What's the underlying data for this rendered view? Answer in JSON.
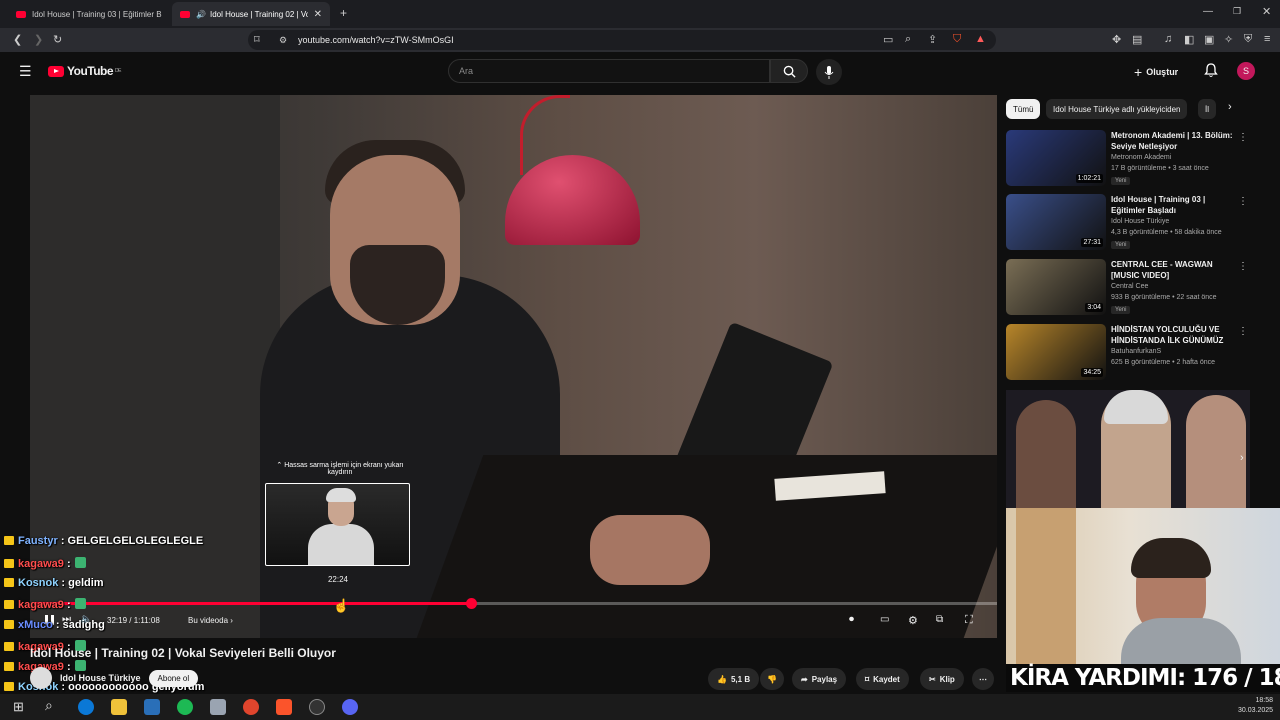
{
  "browser": {
    "tabs": [
      {
        "label": "Idol House | Training 03 | Eğitimler B",
        "active": false
      },
      {
        "label": "Idol House | Training 02 | Vo",
        "active": true
      }
    ],
    "new_tab": "+",
    "url": "youtube.com/watch?v=zTW-SMmOsGI",
    "window_controls": [
      "minimize",
      "restore",
      "close"
    ]
  },
  "youtube": {
    "logo": "YouTube",
    "logo_region": "DE",
    "search_placeholder": "Ara",
    "create_label": "Oluştur",
    "avatar_letter": "S"
  },
  "player": {
    "scrub_hint": "Hassas sarma işlemi için ekranı yukarı kaydırın",
    "preview_time": "22:24",
    "time": "32:19 / 1:11:08",
    "chapter": "Bu videoda",
    "progress_fraction": 0.454,
    "hover_fraction": 0.315
  },
  "video": {
    "title": "Idol House | Training 02 | Vokal Seviyeleri Belli Oluyor",
    "channel": "Idol House Türkiye",
    "subscribe": "Abone ol",
    "likes": "5,1 B",
    "share": "Paylaş",
    "save": "Kaydet",
    "clip": "Klip"
  },
  "sidebar": {
    "chips": [
      "Tümü",
      "Idol House Türkiye adlı yükleyiciden",
      "İl"
    ],
    "recommendations": [
      {
        "title": "Metronom Akademi | 13. Bölüm: Seviye Netleşiyor",
        "channel": "Metronom Akademi",
        "meta": "17 B görüntüleme • 3 saat önce",
        "badge": "Yeni",
        "duration": "1:02:21",
        "thumb_color": "#2a3a7a"
      },
      {
        "title": "Idol House | Training 03 | Eğitimler Başladı",
        "channel": "Idol House Türkiye",
        "meta": "4,3 B görüntüleme • 58 dakika önce",
        "badge": "Yeni",
        "duration": "27:31",
        "thumb_color": "#3a4f8a"
      },
      {
        "title": "CENTRAL CEE - WAGWAN [MUSIC VIDEO]",
        "channel": "Central Cee",
        "meta": "933 B görüntüleme • 22 saat önce",
        "badge": "Yeni",
        "duration": "3:04",
        "thumb_color": "#7a6e55"
      },
      {
        "title": "HİNDİSTAN YOLCULUĞU VE HİNDİSTANDA İLK GÜNÜMÜZ",
        "channel": "BatuhanfurkanS",
        "meta": "625 B görüntüleme • 2 hafta önce",
        "badge": "",
        "duration": "34:25",
        "thumb_color": "#b8862a"
      }
    ]
  },
  "overlay": {
    "chat": [
      {
        "user": "Faustyr",
        "msg": ": GELGELGELGLEGLEGLE",
        "color": "#7fb3ff"
      },
      {
        "user": "kagawa9",
        "msg": ":",
        "color": "#ff4d4d"
      },
      {
        "user": "Kosnok",
        "msg": ": geldim",
        "color": "#8fd3ff"
      },
      {
        "user": "kagawa9",
        "msg": ":",
        "color": "#ff4d4d"
      },
      {
        "user": "xMuco",
        "msg": ": sadighg",
        "color": "#6a8dff"
      },
      {
        "user": "kagawa9",
        "msg": ":",
        "color": "#ff4d4d"
      },
      {
        "user": "kagawa9",
        "msg": ":",
        "color": "#ff4d4d"
      },
      {
        "user": "Kosnok",
        "msg": ": oooooooooooo geliyorum",
        "color": "#8fd3ff"
      }
    ],
    "banner": "KİRA YARDIMI: 176 / 180"
  },
  "taskbar": {
    "time": "18:58",
    "date": "30.03.2025"
  }
}
